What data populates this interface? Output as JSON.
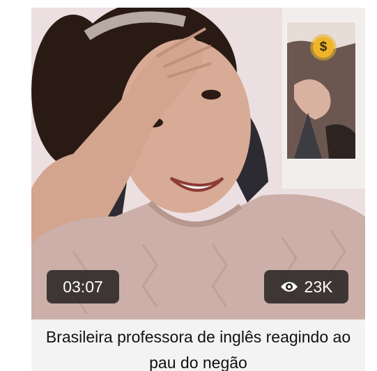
{
  "video": {
    "duration": "03:07",
    "views": "23K",
    "title": "Brasileira professora de inglês reagindo ao pau do negão"
  },
  "icons": {
    "views": "eye-icon",
    "coin": "dollar-coin-icon"
  },
  "colors": {
    "badge_bg": "#141414",
    "coin": "#f0b429",
    "title_bg": "#f3f3f4",
    "title_text": "#111111"
  }
}
